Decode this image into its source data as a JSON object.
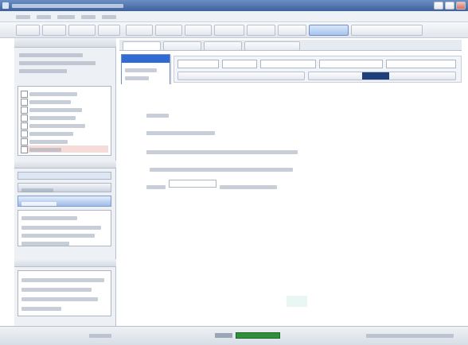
{
  "window": {
    "title": "",
    "menu_items": [
      "",
      "",
      "",
      "",
      ""
    ],
    "colors": {
      "titlebar": "#4b6fa6",
      "toolbar": "#e9edf2",
      "panel": "#edf0f4",
      "accent": "#2f6bd3",
      "status_indicator": "#2f8f3a"
    }
  },
  "toolbar": {
    "buttons": [
      "",
      "",
      "",
      "",
      "",
      "",
      "",
      "",
      "",
      "",
      "",
      ""
    ]
  },
  "left_panel": {
    "header_rows": [
      "",
      "",
      ""
    ],
    "list_items": [
      "",
      "",
      "",
      "",
      "",
      "",
      "",
      ""
    ],
    "options_title": "",
    "options": [
      "",
      "",
      ""
    ],
    "section_title": "",
    "section_lines": [
      "",
      "",
      ""
    ],
    "footer_title": "",
    "footer_lines": [
      "",
      "",
      "",
      ""
    ]
  },
  "tabs": [
    "",
    "",
    "",
    ""
  ],
  "dropdown": {
    "header": "",
    "items": [
      "",
      "",
      "",
      "",
      ""
    ]
  },
  "editor": {
    "format_controls": [
      "",
      "",
      "",
      "",
      "",
      "",
      ""
    ],
    "lines": [
      "",
      "",
      "",
      "",
      ""
    ],
    "input_value": ""
  },
  "statusbar": {
    "left": "",
    "right": ""
  }
}
